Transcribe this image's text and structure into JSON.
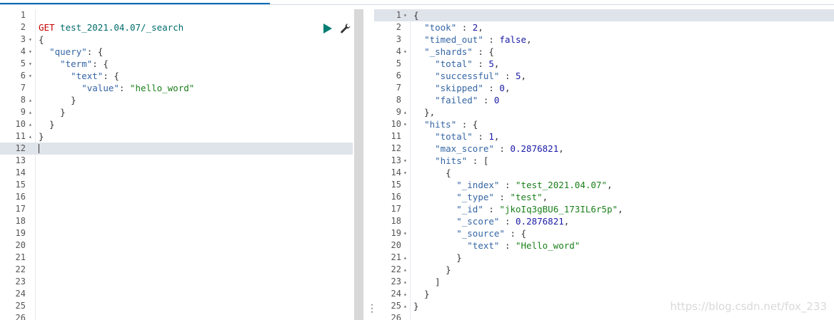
{
  "request": {
    "method": "GET",
    "url": "test_2021.04.07/_search",
    "run_button": "run-request",
    "settings_button": "request-settings"
  },
  "left_lines": [
    {
      "n": "1",
      "fold": "",
      "html": ""
    },
    {
      "n": "2",
      "fold": "",
      "html": "<span class='tk-method'>GET</span> <span class='tk-url'>test_2021.04.07/_search</span>"
    },
    {
      "n": "3",
      "fold": "▾",
      "html": "{"
    },
    {
      "n": "4",
      "fold": "▾",
      "html": "  <span class='tk-key'>\"query\"</span>: {"
    },
    {
      "n": "5",
      "fold": "▾",
      "html": "    <span class='tk-key'>\"term\"</span>: {"
    },
    {
      "n": "6",
      "fold": "▾",
      "html": "      <span class='tk-key'>\"text\"</span>: {"
    },
    {
      "n": "7",
      "fold": "",
      "html": "        <span class='tk-key'>\"value\"</span>: <span class='tk-str'>\"hello_word\"</span>"
    },
    {
      "n": "8",
      "fold": "▴",
      "html": "      }"
    },
    {
      "n": "9",
      "fold": "▴",
      "html": "    }"
    },
    {
      "n": "10",
      "fold": "▴",
      "html": "  }"
    },
    {
      "n": "11",
      "fold": "▴",
      "html": "}"
    },
    {
      "n": "12",
      "fold": "",
      "html": "",
      "active": true
    },
    {
      "n": "13",
      "fold": "",
      "html": ""
    },
    {
      "n": "14",
      "fold": "",
      "html": ""
    },
    {
      "n": "15",
      "fold": "",
      "html": ""
    },
    {
      "n": "16",
      "fold": "",
      "html": ""
    },
    {
      "n": "17",
      "fold": "",
      "html": ""
    },
    {
      "n": "18",
      "fold": "",
      "html": ""
    },
    {
      "n": "19",
      "fold": "",
      "html": ""
    },
    {
      "n": "20",
      "fold": "",
      "html": ""
    },
    {
      "n": "21",
      "fold": "",
      "html": ""
    },
    {
      "n": "22",
      "fold": "",
      "html": ""
    },
    {
      "n": "23",
      "fold": "",
      "html": ""
    },
    {
      "n": "24",
      "fold": "",
      "html": ""
    },
    {
      "n": "25",
      "fold": "",
      "html": ""
    },
    {
      "n": "26",
      "fold": "",
      "html": ""
    }
  ],
  "right_lines": [
    {
      "n": "1",
      "fold": "▾",
      "html": "{",
      "active": true
    },
    {
      "n": "2",
      "fold": "",
      "html": "  <span class='tk-key'>\"took\"</span> : <span class='tk-num'>2</span>,"
    },
    {
      "n": "3",
      "fold": "",
      "html": "  <span class='tk-key'>\"timed_out\"</span> : <span class='tk-bool'>false</span>,"
    },
    {
      "n": "4",
      "fold": "▾",
      "html": "  <span class='tk-key'>\"_shards\"</span> : {"
    },
    {
      "n": "5",
      "fold": "",
      "html": "    <span class='tk-key'>\"total\"</span> : <span class='tk-num'>5</span>,"
    },
    {
      "n": "6",
      "fold": "",
      "html": "    <span class='tk-key'>\"successful\"</span> : <span class='tk-num'>5</span>,"
    },
    {
      "n": "7",
      "fold": "",
      "html": "    <span class='tk-key'>\"skipped\"</span> : <span class='tk-num'>0</span>,"
    },
    {
      "n": "8",
      "fold": "",
      "html": "    <span class='tk-key'>\"failed\"</span> : <span class='tk-num'>0</span>"
    },
    {
      "n": "9",
      "fold": "▴",
      "html": "  },"
    },
    {
      "n": "10",
      "fold": "▾",
      "html": "  <span class='tk-key'>\"hits\"</span> : {"
    },
    {
      "n": "11",
      "fold": "",
      "html": "    <span class='tk-key'>\"total\"</span> : <span class='tk-num'>1</span>,"
    },
    {
      "n": "12",
      "fold": "",
      "html": "    <span class='tk-key'>\"max_score\"</span> : <span class='tk-num'>0.2876821</span>,"
    },
    {
      "n": "13",
      "fold": "▾",
      "html": "    <span class='tk-key'>\"hits\"</span> : ["
    },
    {
      "n": "14",
      "fold": "▾",
      "html": "      {"
    },
    {
      "n": "15",
      "fold": "",
      "html": "        <span class='tk-key'>\"_index\"</span> : <span class='tk-str'>\"test_2021.04.07\"</span>,"
    },
    {
      "n": "16",
      "fold": "",
      "html": "        <span class='tk-key'>\"_type\"</span> : <span class='tk-str'>\"test\"</span>,"
    },
    {
      "n": "17",
      "fold": "",
      "html": "        <span class='tk-key'>\"_id\"</span> : <span class='tk-str'>\"jkoIq3gBU6_173IL6r5p\"</span>,"
    },
    {
      "n": "18",
      "fold": "",
      "html": "        <span class='tk-key'>\"_score\"</span> : <span class='tk-num'>0.2876821</span>,"
    },
    {
      "n": "19",
      "fold": "▾",
      "html": "        <span class='tk-key'>\"_source\"</span> : {"
    },
    {
      "n": "20",
      "fold": "",
      "html": "          <span class='tk-key'>\"text\"</span> : <span class='tk-str'>\"Hello_word\"</span>"
    },
    {
      "n": "21",
      "fold": "▴",
      "html": "        }"
    },
    {
      "n": "22",
      "fold": "▴",
      "html": "      }"
    },
    {
      "n": "23",
      "fold": "▴",
      "html": "    ]"
    },
    {
      "n": "24",
      "fold": "▴",
      "html": "  }"
    },
    {
      "n": "25",
      "fold": "▴",
      "html": "}"
    },
    {
      "n": "26",
      "fold": "",
      "html": ""
    }
  ],
  "watermark": "https://blog.csdn.net/fox_233",
  "resizer_glyph": "⋮"
}
